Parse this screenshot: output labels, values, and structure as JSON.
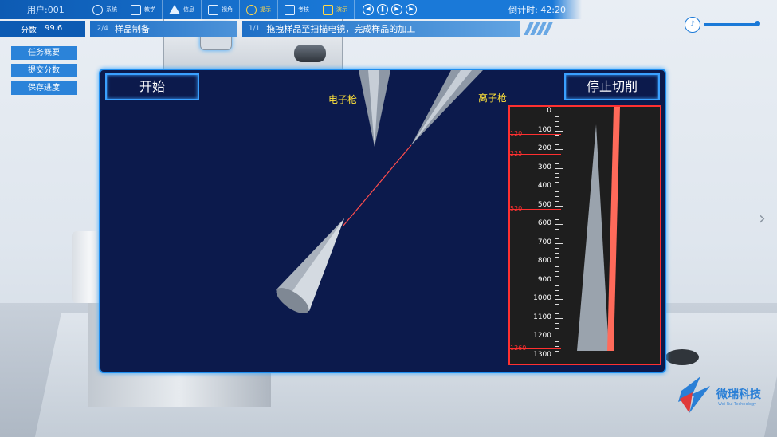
{
  "topbar": {
    "user": "用户:001",
    "nav": [
      {
        "label": "系统",
        "icon": "globe-icon"
      },
      {
        "label": "教学",
        "icon": "teaching-icon"
      },
      {
        "label": "信息",
        "icon": "warning-icon"
      },
      {
        "label": "视角",
        "icon": "image-icon"
      },
      {
        "label": "提示",
        "icon": "help-icon"
      },
      {
        "label": "考核",
        "icon": "clipboard-icon"
      },
      {
        "label": "演示",
        "icon": "monitor-icon"
      }
    ],
    "countdown": "倒计时: 42:20"
  },
  "secondbar": {
    "score_label": "分数",
    "score_value": "99.6",
    "step_frac": "2/4",
    "step_label": "样品制备",
    "task_frac": "1/1",
    "task_label": "拖拽样品至扫描电镜，完成样品的加工"
  },
  "sidebar": {
    "items": [
      "任务概要",
      "提交分数",
      "保存进度"
    ]
  },
  "panel": {
    "start_button": "开始",
    "stop_button": "停止切削",
    "electron_gun_label": "电子枪",
    "ion_gun_label": "离子枪"
  },
  "gauge": {
    "ticks": [
      "0",
      "100",
      "200",
      "300",
      "400",
      "500",
      "600",
      "700",
      "800",
      "900",
      "1000",
      "1100",
      "1200",
      "1300"
    ],
    "marks": [
      "120",
      "225",
      "520",
      "1260"
    ],
    "max": 1300,
    "mark_values": [
      120,
      225,
      520,
      1260
    ]
  },
  "logo": {
    "name": "微瑞科技",
    "subtitle": "Wei Rui Technology"
  },
  "colors": {
    "accent": "#1a79d8",
    "panel_bg": "#0c1a4c",
    "gauge_red": "#ff3030",
    "beam": "#ff4d4d",
    "label_yellow": "#ffe23a"
  }
}
